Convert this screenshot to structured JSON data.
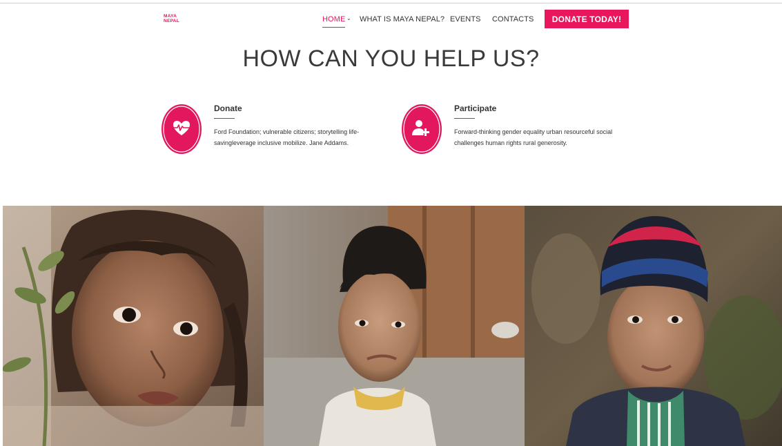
{
  "logo": {
    "line1": "MAYA",
    "line2": "NEPAL"
  },
  "nav": {
    "items": [
      {
        "label": "HOME",
        "active": true
      },
      {
        "label": "WHAT IS MAYA NEPAL?",
        "active": false
      },
      {
        "label": "EVENTS",
        "active": false
      },
      {
        "label": "CONTACTS",
        "active": false
      }
    ],
    "donate_label": "DONATE TODAY!"
  },
  "hero": {
    "title": "HOW CAN YOU HELP US?"
  },
  "cards": [
    {
      "icon": "heart-pulse-icon",
      "title": "Donate",
      "text": "Ford Foundation; vulnerable citizens; storytelling life-savingleverage inclusive mobilize. Jane Addams."
    },
    {
      "icon": "add-user-icon",
      "title": "Participate",
      "text": "Forward-thinking gender equality urban resourceful social challenges human rights rural generosity."
    }
  ],
  "colors": {
    "accent": "#e2175e",
    "text": "#333333",
    "title": "#3a3a3a"
  }
}
